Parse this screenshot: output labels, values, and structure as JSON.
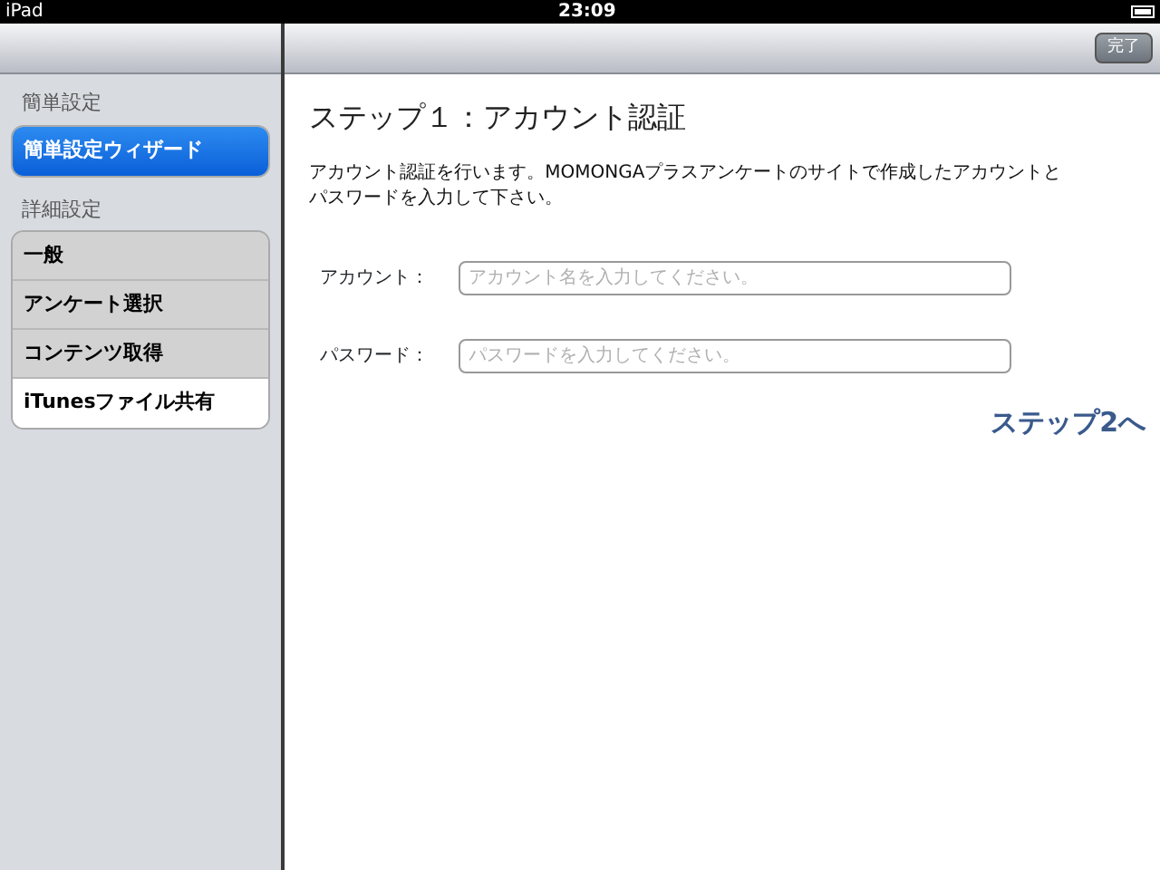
{
  "status_bar": {
    "device": "iPad",
    "time": "23:09"
  },
  "nav_bar": {
    "done_button": "完了"
  },
  "sidebar": {
    "sections": [
      {
        "header": "簡単設定",
        "items": [
          {
            "label": "簡単設定ウィザード",
            "selected": true,
            "disabled": false
          }
        ]
      },
      {
        "header": "詳細設定",
        "items": [
          {
            "label": "一般",
            "selected": false,
            "disabled": true
          },
          {
            "label": "アンケート選択",
            "selected": false,
            "disabled": true
          },
          {
            "label": "コンテンツ取得",
            "selected": false,
            "disabled": true
          },
          {
            "label": "iTunesファイル共有",
            "selected": false,
            "disabled": false
          }
        ]
      }
    ]
  },
  "content": {
    "title": "ステップ１：アカウント認証",
    "description": "アカウント認証を行います。MOMONGAプラスアンケートのサイトで作成したアカウントとパスワードを入力して下さい。",
    "fields": [
      {
        "label": "アカウント：",
        "placeholder": "アカウント名を入力してください。"
      },
      {
        "label": "パスワード：",
        "placeholder": "パスワードを入力してください。"
      }
    ],
    "next_link": "ステップ2へ"
  }
}
